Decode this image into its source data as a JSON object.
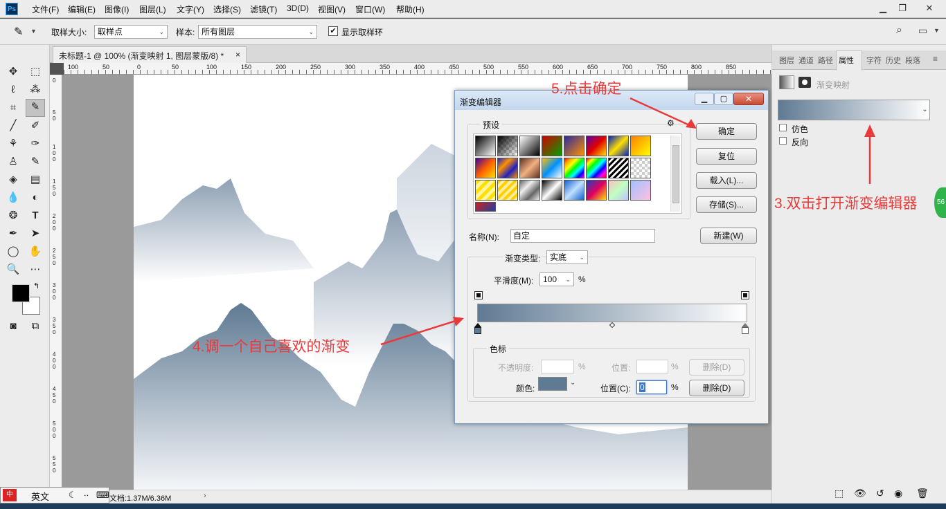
{
  "menubar": {
    "logo": "Ps",
    "items": [
      "文件(F)",
      "编辑(E)",
      "图像(I)",
      "图层(L)",
      "文字(Y)",
      "选择(S)",
      "滤镜(T)",
      "3D(D)",
      "视图(V)",
      "窗口(W)",
      "帮助(H)"
    ],
    "minimize": "▁",
    "restore": "❐",
    "close": "✕"
  },
  "options": {
    "sample_size_label": "取样大小:",
    "sample_size_value": "取样点",
    "sample_label": "样本:",
    "sample_value": "所有图层",
    "show_ring_label": "显示取样环",
    "show_ring_checked": true
  },
  "document": {
    "tab_title": "未标题-1 @ 100% (渐变映射 1, 图层蒙版/8) *",
    "tab_close": "×",
    "ruler_h": [
      "100",
      "50",
      "0",
      "50",
      "100",
      "150",
      "200",
      "250",
      "300",
      "350",
      "400",
      "450",
      "500",
      "550",
      "600",
      "650",
      "700",
      "750",
      "800",
      "850"
    ],
    "ruler_v": [
      "0",
      "5 0",
      "1 0 0",
      "1 5 0",
      "2 0 0",
      "2 5 0",
      "3 0 0",
      "3 5 0",
      "4 0 0",
      "4 5 0",
      "5 0 0",
      "5 5 0"
    ],
    "status": "文档:1.37M/6.36M"
  },
  "ime": {
    "lang": "英文"
  },
  "right_panel": {
    "tabs": [
      "图层",
      "通道",
      "路径",
      "属性",
      "字符",
      "历史",
      "段落"
    ],
    "active_tab": "属性",
    "adjustment_name": "渐变映射",
    "dither_label": "仿色",
    "reverse_label": "反向",
    "gradient_start_color": "#5f7a93",
    "gradient_end_color": "#ffffff"
  },
  "dialog": {
    "title": "渐变编辑器",
    "presets_label": "预设",
    "ok": "确定",
    "reset": "复位",
    "load": "载入(L)...",
    "save": "存储(S)...",
    "name_label": "名称(N):",
    "name_value": "自定",
    "new": "新建(W)",
    "gradient_type_label": "渐变类型:",
    "gradient_type_value": "实底",
    "smoothness_label": "平滑度(M):",
    "smoothness_value": "100",
    "percent": "%",
    "color_stops_label": "色标",
    "opacity_label": "不透明度:",
    "location_label": "位置:",
    "delete_label": "删除(D)",
    "color_label": "颜色:",
    "location_c_label": "位置(C):",
    "location_value": "0",
    "stop_color": "#5f7a93",
    "gradient_start": "#5f7a93",
    "gradient_end": "#ffffff"
  },
  "annotations": {
    "a3": "3.双击打开渐变编辑器",
    "a4": "4.调一个自己喜欢的渐变",
    "a5": "5.点击确定"
  }
}
